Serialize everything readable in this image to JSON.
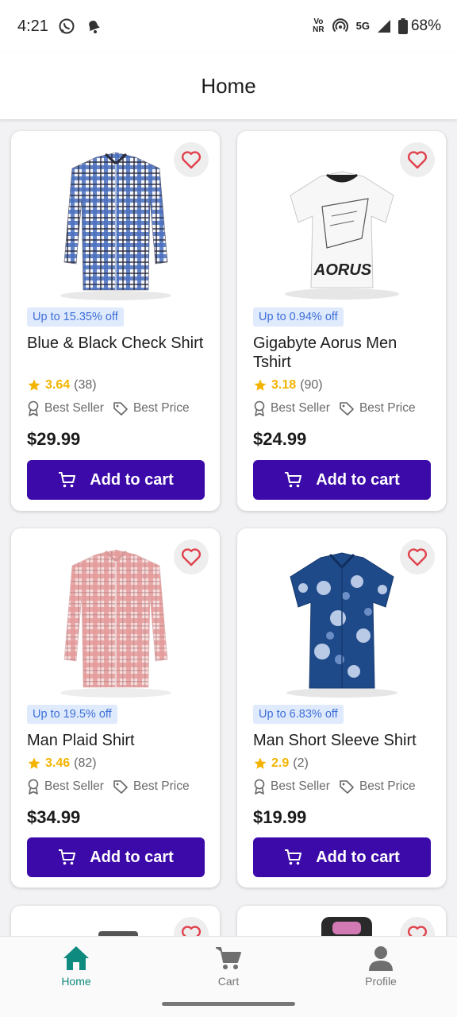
{
  "status_bar": {
    "time": "4:21",
    "icons": [
      "whatsapp-icon",
      "notification-bell-icon",
      "volte-nr-icon",
      "hotspot-icon",
      "5g-icon",
      "signal-icon",
      "battery-icon"
    ],
    "volte_top": "Vo",
    "volte_bottom": "NR",
    "network": "5G",
    "battery": "68%"
  },
  "header": {
    "title": "Home"
  },
  "products": [
    {
      "name": "Blue & Black Check Shirt",
      "discount": "Up to 15.35% off",
      "rating": "3.64",
      "reviews": "(38)",
      "tag_best_seller": "Best Seller",
      "tag_best_price": "Best Price",
      "price": "$29.99",
      "button": "Add to cart",
      "image": "blue-check-shirt"
    },
    {
      "name": "Gigabyte Aorus Men Tshirt",
      "discount": "Up to 0.94% off",
      "rating": "3.18",
      "reviews": "(90)",
      "tag_best_seller": "Best Seller",
      "tag_best_price": "Best Price",
      "price": "$24.99",
      "button": "Add to cart",
      "image": "aorus-tshirt",
      "image_text": "AORUS"
    },
    {
      "name": "Man Plaid Shirt",
      "discount": "Up to 19.5% off",
      "rating": "3.46",
      "reviews": "(82)",
      "tag_best_seller": "Best Seller",
      "tag_best_price": "Best Price",
      "price": "$34.99",
      "button": "Add to cart",
      "image": "red-plaid-shirt"
    },
    {
      "name": "Man Short Sleeve Shirt",
      "discount": "Up to 6.83% off",
      "rating": "2.9",
      "reviews": "(2)",
      "tag_best_seller": "Best Seller",
      "tag_best_price": "Best Price",
      "price": "$19.99",
      "button": "Add to cart",
      "image": "blue-floral-shirt"
    }
  ],
  "bottom_nav": {
    "items": [
      {
        "label": "Home",
        "icon": "home-icon",
        "active": true
      },
      {
        "label": "Cart",
        "icon": "cart-icon",
        "active": false
      },
      {
        "label": "Profile",
        "icon": "profile-icon",
        "active": false
      }
    ]
  },
  "colors": {
    "primary_button": "#3c0aa8",
    "active_nav": "#0f8a7e",
    "rating_star": "#f3b400",
    "discount_bg": "#dfeafc",
    "discount_text": "#3d6fd8",
    "favorite_heart": "#e0424d"
  }
}
